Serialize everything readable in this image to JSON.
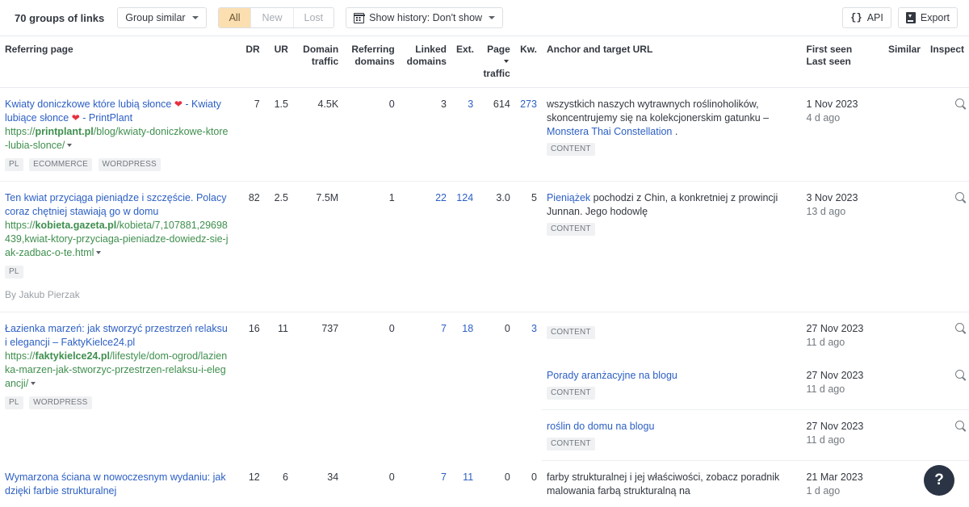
{
  "toolbar": {
    "count_label": "70 groups of links",
    "group_similar_label": "Group similar",
    "filters": [
      {
        "label": "All",
        "active": true
      },
      {
        "label": "New",
        "active": false
      },
      {
        "label": "Lost",
        "active": false
      }
    ],
    "history_label": "Show history: Don't show",
    "api_label": "API",
    "export_label": "Export",
    "accent_color": "#fbdfb1",
    "link_color": "#2c5fc4",
    "url_color": "#3f8f4e"
  },
  "columns": {
    "referring_page": "Referring page",
    "dr": "DR",
    "ur": "UR",
    "domain_traffic_1": "Domain",
    "domain_traffic_2": "traffic",
    "referring_domains_1": "Referring",
    "referring_domains_2": "domains",
    "linked_domains_1": "Linked",
    "linked_domains_2": "domains",
    "ext": "Ext.",
    "page_traffic_1": "Page",
    "page_traffic_2": "traffic",
    "kw": "Kw.",
    "anchor": "Anchor and target URL",
    "first_seen": "First seen",
    "last_seen": "Last seen",
    "similar": "Similar",
    "inspect": "Inspect"
  },
  "rows": [
    {
      "title_line1": "Kwiaty doniczkowe które lubią słonce",
      "title_heart1": "❤",
      "title_mid": " - ",
      "title_line2": "Kwiaty lubiące słonce",
      "title_heart2": "❤",
      "title_tail": " - PrintPlant",
      "url_scheme": "https://",
      "url_domain": "printplant.pl",
      "url_path": "/blog/kwiaty-doniczkowe-ktore-lubia-slonce/",
      "tags": [
        "PL",
        "ECOMMERCE",
        "WORDPRESS"
      ],
      "byline": "",
      "dr": "7",
      "ur": "1.5",
      "domain_traffic": "4.5K",
      "referring_domains": "0",
      "linked_domains": "3",
      "ext": "3",
      "ext_is_link": true,
      "page_traffic": "614",
      "kw": "273",
      "kw_is_link": true,
      "anchor_pre": "wszystkich naszych wytrawnych roślinoholików, skoncentrujemy się na kolekcjonerskim gatunku – ",
      "anchor_link": "Monstera Thai Constellation",
      "anchor_post": " .",
      "badge": "CONTENT",
      "first_seen": "1 Nov 2023",
      "last_seen": "4 d ago",
      "similar": "",
      "inspect_icon": "magnifier-icon"
    },
    {
      "title_line1": "Ten kwiat przyciąga pieniądze i szczęście.",
      "title_line2": "Polacy coraz chętniej stawiają go w domu",
      "url_scheme": "https://",
      "url_domain": "kobieta.gazeta.pl",
      "url_path": "/kobieta/7,107881,29698439,kwiat-ktory-przyciaga-pieniadze-dowiedz-sie-jak-zadbac-o-te.html",
      "tags": [
        "PL"
      ],
      "byline": "By Jakub Pierzak",
      "dr": "82",
      "ur": "2.5",
      "domain_traffic": "7.5M",
      "referring_domains": "1",
      "linked_domains": "22",
      "linked_is_link": true,
      "ext": "124",
      "ext_is_link": true,
      "page_traffic": "3.0",
      "kw": "5",
      "kw_is_link": false,
      "anchor_link": "Pieniążek",
      "anchor_post": " pochodzi z Chin, a konkretniej z prowincji Junnan. Jego hodowlę",
      "badge": "CONTENT",
      "first_seen": "3 Nov 2023",
      "last_seen": "13 d ago",
      "similar": "",
      "inspect_icon": "magnifier-icon"
    },
    {
      "title_line1": "Łazienka marzeń: jak stworzyć przestrzeń",
      "title_line2": "relaksu i elegancji – FaktyKielce24.pl",
      "url_scheme": "https://",
      "url_domain": "faktykielce24.pl",
      "url_path": "/lifestyle/dom-ogrod/lazienka-marzen-jak-stworzyc-przestrzen-relaksu-i-elegancji/",
      "tags": [
        "PL",
        "WORDPRESS"
      ],
      "byline": "",
      "dr": "16",
      "ur": "11",
      "domain_traffic": "737",
      "referring_domains": "0",
      "linked_domains": "7",
      "linked_is_link": true,
      "ext": "18",
      "ext_is_link": true,
      "page_traffic": "0",
      "kw": "3",
      "kw_is_link": true,
      "anchor_pre": "",
      "anchor_link": "",
      "anchor_post": "",
      "badge": "CONTENT",
      "first_seen": "27 Nov 2023",
      "last_seen": "11 d ago",
      "similar": "",
      "inspect_icon": "magnifier-icon",
      "sub_rows": [
        {
          "anchor_link": "Porady aranżacyjne na blogu",
          "badge": "CONTENT",
          "first_seen": "27 Nov 2023",
          "last_seen": "11 d ago",
          "inspect_icon": "magnifier-icon"
        },
        {
          "anchor_link": "roślin do domu na blogu",
          "badge": "CONTENT",
          "first_seen": "27 Nov 2023",
          "last_seen": "11 d ago",
          "inspect_icon": "magnifier-icon"
        }
      ]
    },
    {
      "title_line1": "Wymarzona ściana w nowoczesnym",
      "title_line2": "wydaniu: jak dzięki farbie strukturalnej",
      "url_scheme": "",
      "url_domain": "",
      "url_path": "",
      "tags": [],
      "byline": "",
      "dr": "12",
      "ur": "6",
      "domain_traffic": "34",
      "referring_domains": "0",
      "linked_domains": "7",
      "linked_is_link": true,
      "ext": "11",
      "ext_is_link": true,
      "page_traffic": "0",
      "kw": "0",
      "kw_is_link": false,
      "anchor_pre": "farby strukturalnej i jej właściwości, zobacz poradnik malowania farbą strukturalną na",
      "anchor_link": "",
      "anchor_post": "",
      "badge": "",
      "first_seen": "21 Mar 2023",
      "last_seen": "1 d ago",
      "similar": "",
      "inspect_icon": ""
    }
  ],
  "help": {
    "label": "?"
  }
}
